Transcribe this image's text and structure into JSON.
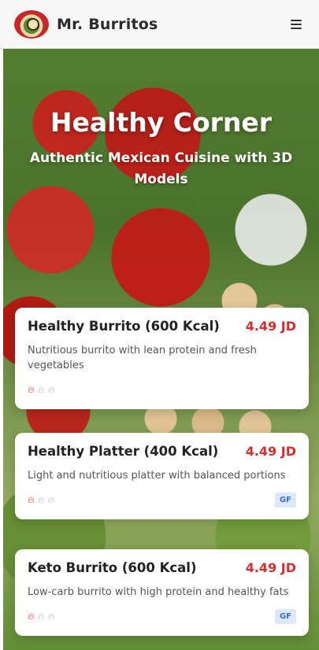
{
  "header": {
    "brand": "Mr. Burritos",
    "logo_icon": "burrito-mascot-logo",
    "menu_icon": "hamburger-menu-icon"
  },
  "hero": {
    "title": "Healthy Corner",
    "subtitle": "Authentic Mexican Cuisine with 3D Models"
  },
  "menu_items": [
    {
      "title": "Healthy Burrito (600 Kcal)",
      "price": "4.49 JD",
      "description": "Nutritious burrito with lean protein and fresh vegetables",
      "spice_level": 1,
      "spice_max": 3,
      "badge": ""
    },
    {
      "title": "Healthy Platter (400 Kcal)",
      "price": "4.49 JD",
      "description": "Light and nutritious platter with balanced portions",
      "spice_level": 1,
      "spice_max": 3,
      "badge": "GF"
    },
    {
      "title": "Keto Burrito (600 Kcal)",
      "price": "4.49 JD",
      "description": "Low-carb burrito with high protein and healthy fats",
      "spice_level": 1,
      "spice_max": 3,
      "badge": "GF"
    }
  ],
  "colors": {
    "price": "#d32f2f",
    "spice_active": "#e03b2b",
    "spice_inactive": "#bdbdbd",
    "badge_text": "#3b6fd4",
    "badge_bg": "#dde8fb"
  }
}
